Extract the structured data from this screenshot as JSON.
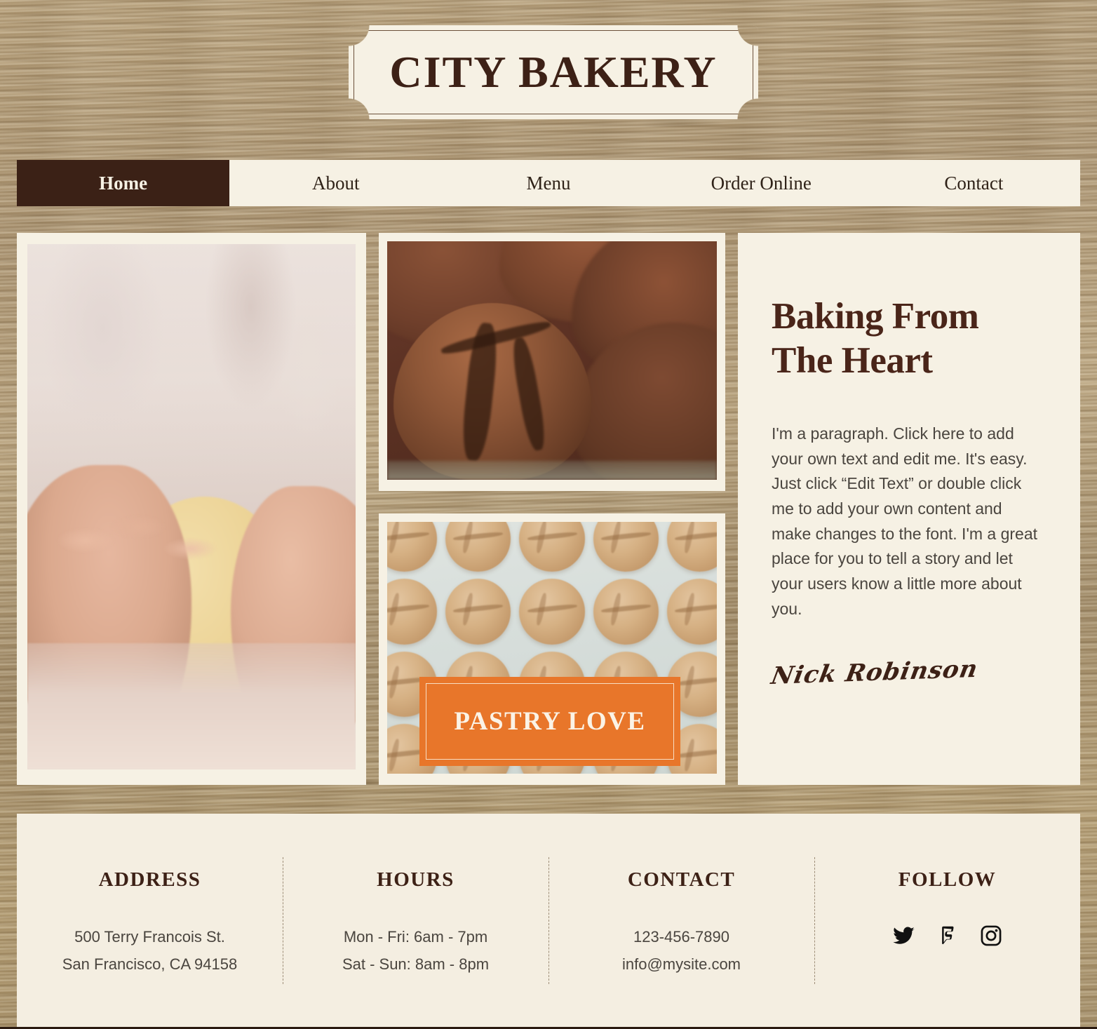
{
  "site": {
    "logo_text": "CITY BAKERY",
    "accent_orange": "#e8762a",
    "cream": "#f6f1e4",
    "dark_brown": "#3b2116",
    "wood_tan": "#ab9471"
  },
  "nav": {
    "items": [
      {
        "label": "Home",
        "active": true
      },
      {
        "label": "About",
        "active": false
      },
      {
        "label": "Menu",
        "active": false
      },
      {
        "label": "Order Online",
        "active": false
      },
      {
        "label": "Contact",
        "active": false
      }
    ]
  },
  "hero": {
    "banner_label": "PASTRY LOVE",
    "heading": "Baking From The Heart",
    "paragraph": "I'm a paragraph. Click here to add your own text and edit me. It's easy. Just click “Edit Text” or double click me to add your own content and make changes to the font. I'm a great place for you to tell a story and let your users know a little more about you.",
    "signature": "Nick Robinson",
    "images": [
      {
        "name": "hands-kneading-dough",
        "alt": "Baker's hands kneading dough on a floured surface"
      },
      {
        "name": "chocolate-muffins",
        "alt": "Close-up of chocolate muffins"
      },
      {
        "name": "cookies-on-tray",
        "alt": "Rows of crackled cookies on a baking tray"
      }
    ]
  },
  "footer": {
    "columns": [
      {
        "title": "ADDRESS",
        "lines": [
          "500 Terry Francois St.",
          "San Francisco, CA 94158"
        ]
      },
      {
        "title": "HOURS",
        "lines": [
          "Mon - Fri: 6am - 7pm",
          "Sat - Sun: 8am - 8pm"
        ]
      },
      {
        "title": "CONTACT",
        "lines": [
          "123-456-7890",
          "info@mysite.com"
        ]
      },
      {
        "title": "FOLLOW",
        "lines": [],
        "social": [
          {
            "name": "twitter-icon",
            "label": "Twitter"
          },
          {
            "name": "foursquare-icon",
            "label": "Foursquare"
          },
          {
            "name": "instagram-icon",
            "label": "Instagram"
          }
        ]
      }
    ]
  }
}
